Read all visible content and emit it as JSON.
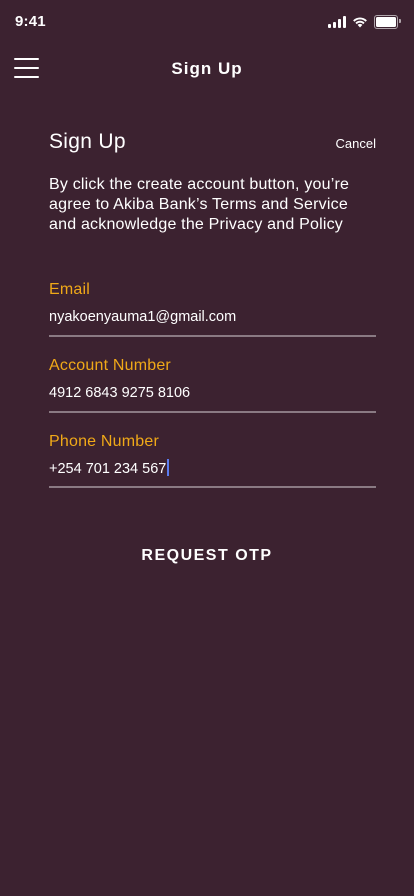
{
  "status_bar": {
    "time": "9:41"
  },
  "nav": {
    "title": "Sign Up"
  },
  "form": {
    "heading": "Sign Up",
    "cancel_label": "Cancel",
    "terms_text": "By click the create account button, you’re agree to Akiba Bank’s Terms and Service and acknowledge the Privacy and Policy",
    "email": {
      "label": "Email",
      "value": "nyakoenyauma1@gmail.com"
    },
    "account_number": {
      "label": "Account Number",
      "value": "4912 6843 9275 8106"
    },
    "phone_number": {
      "label": "Phone Number",
      "value": "+254 701 234 567"
    },
    "submit_label": "REQUEST OTP"
  },
  "colors": {
    "background": "#3c2230",
    "label_accent": "#f0a918",
    "underline": "#8a7a83",
    "caret": "#5b7cf0"
  },
  "icons": [
    "signal-icon",
    "wifi-icon",
    "battery-icon",
    "hamburger-menu-icon"
  ]
}
